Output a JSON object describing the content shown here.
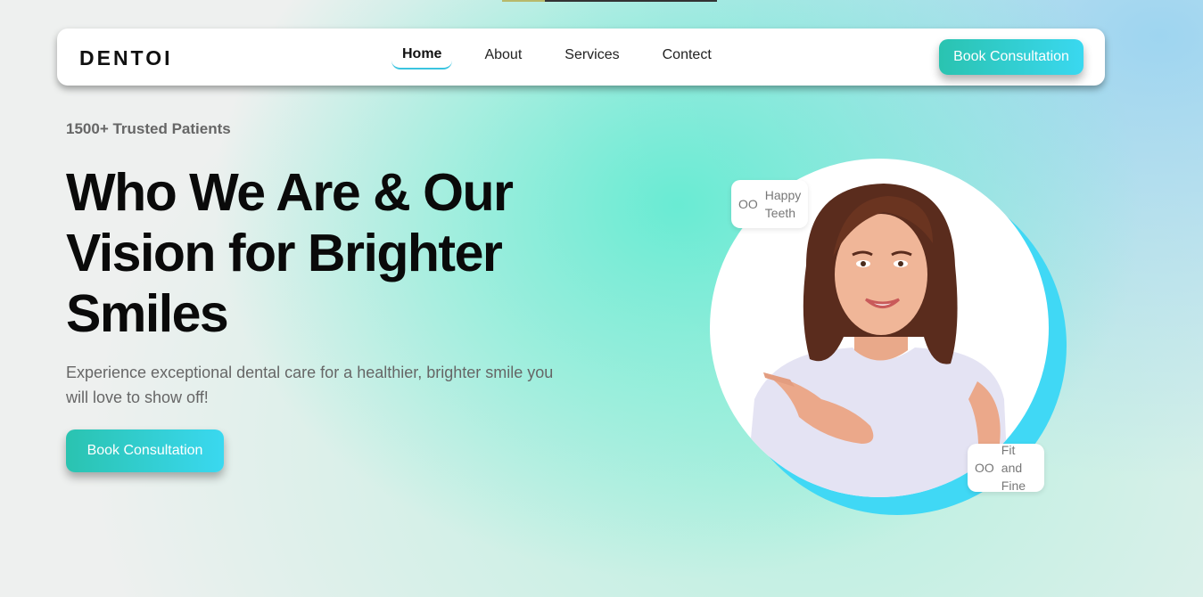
{
  "nav": {
    "logo": "DENTOI",
    "links": [
      {
        "label": "Home",
        "active": true
      },
      {
        "label": "About"
      },
      {
        "label": "Services"
      },
      {
        "label": "Contect"
      }
    ],
    "cta": "Book Consultation"
  },
  "hero": {
    "eyebrow": "1500+ Trusted Patients",
    "headline": "Who We Are & Our Vision for Brighter Smiles",
    "subtext": "Experience exceptional dental care for a healthier, brighter smile you will love to show off!",
    "cta": "Book Consultation"
  },
  "badges": [
    {
      "icon": "OO",
      "line1": "Happy",
      "line2": "Teeth"
    },
    {
      "icon": "OO",
      "line1": "Fit and",
      "line2": "Fine"
    }
  ],
  "colors": {
    "accent_gradient_start": "#2ac3b0",
    "accent_gradient_end": "#3ad8f0",
    "circle_accent": "#40d8f5"
  }
}
